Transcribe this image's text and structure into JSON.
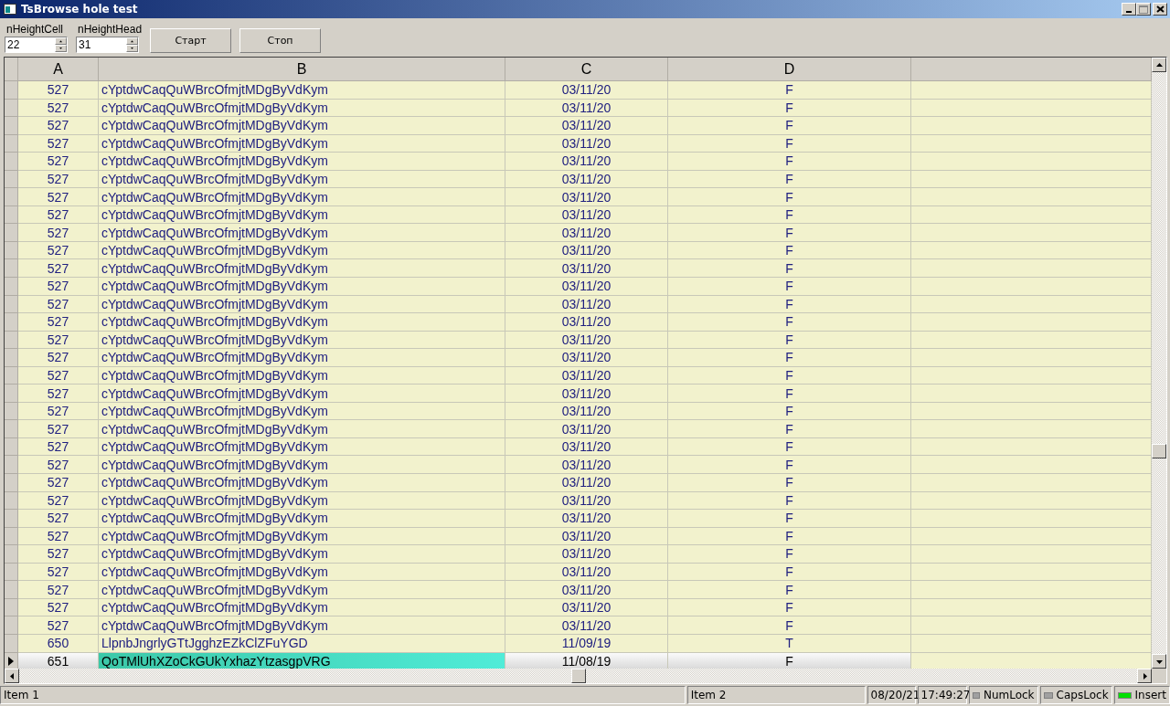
{
  "window": {
    "title": "TsBrowse hole test"
  },
  "toolbar": {
    "fields": [
      {
        "label": "nHeightCell",
        "value": "22"
      },
      {
        "label": "nHeightHead",
        "value": "31"
      }
    ],
    "buttons": [
      "Старт",
      "Стоп"
    ]
  },
  "grid": {
    "columns": [
      "A",
      "B",
      "C",
      "D"
    ],
    "rows": [
      {
        "a": "527",
        "b": "cYptdwCaqQuWBrcOfmjtMDgByVdKym",
        "c": "03/11/20",
        "d": "F",
        "selected": false
      },
      {
        "a": "527",
        "b": "cYptdwCaqQuWBrcOfmjtMDgByVdKym",
        "c": "03/11/20",
        "d": "F",
        "selected": false
      },
      {
        "a": "527",
        "b": "cYptdwCaqQuWBrcOfmjtMDgByVdKym",
        "c": "03/11/20",
        "d": "F",
        "selected": false
      },
      {
        "a": "527",
        "b": "cYptdwCaqQuWBrcOfmjtMDgByVdKym",
        "c": "03/11/20",
        "d": "F",
        "selected": false
      },
      {
        "a": "527",
        "b": "cYptdwCaqQuWBrcOfmjtMDgByVdKym",
        "c": "03/11/20",
        "d": "F",
        "selected": false
      },
      {
        "a": "527",
        "b": "cYptdwCaqQuWBrcOfmjtMDgByVdKym",
        "c": "03/11/20",
        "d": "F",
        "selected": false
      },
      {
        "a": "527",
        "b": "cYptdwCaqQuWBrcOfmjtMDgByVdKym",
        "c": "03/11/20",
        "d": "F",
        "selected": false
      },
      {
        "a": "527",
        "b": "cYptdwCaqQuWBrcOfmjtMDgByVdKym",
        "c": "03/11/20",
        "d": "F",
        "selected": false
      },
      {
        "a": "527",
        "b": "cYptdwCaqQuWBrcOfmjtMDgByVdKym",
        "c": "03/11/20",
        "d": "F",
        "selected": false
      },
      {
        "a": "527",
        "b": "cYptdwCaqQuWBrcOfmjtMDgByVdKym",
        "c": "03/11/20",
        "d": "F",
        "selected": false
      },
      {
        "a": "527",
        "b": "cYptdwCaqQuWBrcOfmjtMDgByVdKym",
        "c": "03/11/20",
        "d": "F",
        "selected": false
      },
      {
        "a": "527",
        "b": "cYptdwCaqQuWBrcOfmjtMDgByVdKym",
        "c": "03/11/20",
        "d": "F",
        "selected": false
      },
      {
        "a": "527",
        "b": "cYptdwCaqQuWBrcOfmjtMDgByVdKym",
        "c": "03/11/20",
        "d": "F",
        "selected": false
      },
      {
        "a": "527",
        "b": "cYptdwCaqQuWBrcOfmjtMDgByVdKym",
        "c": "03/11/20",
        "d": "F",
        "selected": false
      },
      {
        "a": "527",
        "b": "cYptdwCaqQuWBrcOfmjtMDgByVdKym",
        "c": "03/11/20",
        "d": "F",
        "selected": false
      },
      {
        "a": "527",
        "b": "cYptdwCaqQuWBrcOfmjtMDgByVdKym",
        "c": "03/11/20",
        "d": "F",
        "selected": false
      },
      {
        "a": "527",
        "b": "cYptdwCaqQuWBrcOfmjtMDgByVdKym",
        "c": "03/11/20",
        "d": "F",
        "selected": false
      },
      {
        "a": "527",
        "b": "cYptdwCaqQuWBrcOfmjtMDgByVdKym",
        "c": "03/11/20",
        "d": "F",
        "selected": false
      },
      {
        "a": "527",
        "b": "cYptdwCaqQuWBrcOfmjtMDgByVdKym",
        "c": "03/11/20",
        "d": "F",
        "selected": false
      },
      {
        "a": "527",
        "b": "cYptdwCaqQuWBrcOfmjtMDgByVdKym",
        "c": "03/11/20",
        "d": "F",
        "selected": false
      },
      {
        "a": "527",
        "b": "cYptdwCaqQuWBrcOfmjtMDgByVdKym",
        "c": "03/11/20",
        "d": "F",
        "selected": false
      },
      {
        "a": "527",
        "b": "cYptdwCaqQuWBrcOfmjtMDgByVdKym",
        "c": "03/11/20",
        "d": "F",
        "selected": false
      },
      {
        "a": "527",
        "b": "cYptdwCaqQuWBrcOfmjtMDgByVdKym",
        "c": "03/11/20",
        "d": "F",
        "selected": false
      },
      {
        "a": "527",
        "b": "cYptdwCaqQuWBrcOfmjtMDgByVdKym",
        "c": "03/11/20",
        "d": "F",
        "selected": false
      },
      {
        "a": "527",
        "b": "cYptdwCaqQuWBrcOfmjtMDgByVdKym",
        "c": "03/11/20",
        "d": "F",
        "selected": false
      },
      {
        "a": "527",
        "b": "cYptdwCaqQuWBrcOfmjtMDgByVdKym",
        "c": "03/11/20",
        "d": "F",
        "selected": false
      },
      {
        "a": "527",
        "b": "cYptdwCaqQuWBrcOfmjtMDgByVdKym",
        "c": "03/11/20",
        "d": "F",
        "selected": false
      },
      {
        "a": "527",
        "b": "cYptdwCaqQuWBrcOfmjtMDgByVdKym",
        "c": "03/11/20",
        "d": "F",
        "selected": false
      },
      {
        "a": "527",
        "b": "cYptdwCaqQuWBrcOfmjtMDgByVdKym",
        "c": "03/11/20",
        "d": "F",
        "selected": false
      },
      {
        "a": "527",
        "b": "cYptdwCaqQuWBrcOfmjtMDgByVdKym",
        "c": "03/11/20",
        "d": "F",
        "selected": false
      },
      {
        "a": "527",
        "b": "cYptdwCaqQuWBrcOfmjtMDgByVdKym",
        "c": "03/11/20",
        "d": "F",
        "selected": false
      },
      {
        "a": "650",
        "b": "LlpnbJngrlyGTtJgghzEZkClZFuYGD",
        "c": "11/09/19",
        "d": "T",
        "selected": false
      },
      {
        "a": "651",
        "b": "QoTMlUhXZoCkGUkYxhazYtzasgpVRG",
        "c": "11/08/19",
        "d": "F",
        "selected": true
      }
    ]
  },
  "status_bar": {
    "panels": [
      {
        "kind": "text",
        "text": "Item 1"
      },
      {
        "kind": "text",
        "text": "Item 2"
      },
      {
        "kind": "text",
        "text": "08/20/21"
      },
      {
        "kind": "text",
        "text": "17:49:27"
      },
      {
        "kind": "indicator",
        "text": "NumLock",
        "on": false
      },
      {
        "kind": "indicator",
        "text": "CapsLock",
        "on": false
      },
      {
        "kind": "indicator",
        "text": "Insert",
        "on": true
      }
    ]
  }
}
